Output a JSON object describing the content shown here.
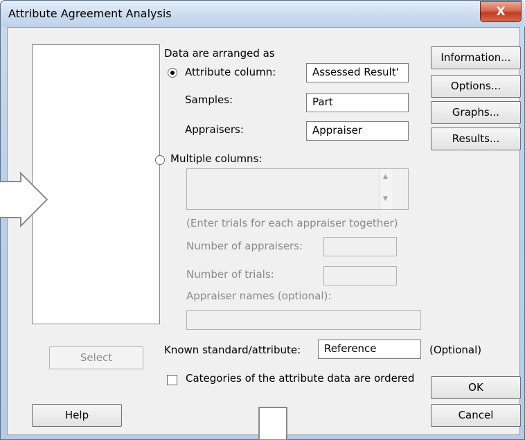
{
  "window": {
    "title": "Attribute Agreement Analysis",
    "close_glyph": "X"
  },
  "data_section": {
    "heading": "Data are arranged as",
    "attribute_column": {
      "label": "Attribute column:",
      "value": "Assessed Result'",
      "selected": true
    },
    "samples": {
      "label": "Samples:",
      "value": "Part"
    },
    "appraisers": {
      "label": "Appraisers:",
      "value": "Appraiser"
    },
    "multiple_columns": {
      "label": "Multiple columns:",
      "selected": false,
      "hint": "(Enter trials for each appraiser together)",
      "num_appraisers_label": "Number of appraisers:",
      "num_trials_label": "Number of trials:",
      "appraiser_names_label": "Appraiser names (optional):"
    }
  },
  "known_standard": {
    "label": "Known standard/attribute:",
    "value": "Reference",
    "optional_note": "(Optional)"
  },
  "ordered_checkbox": {
    "label": "Categories of the attribute data are ordered",
    "checked": false
  },
  "buttons": {
    "information": "Information...",
    "options": "Options...",
    "graphs": "Graphs...",
    "results": "Results...",
    "select": "Select",
    "help": "Help",
    "ok": "OK",
    "cancel": "Cancel"
  }
}
